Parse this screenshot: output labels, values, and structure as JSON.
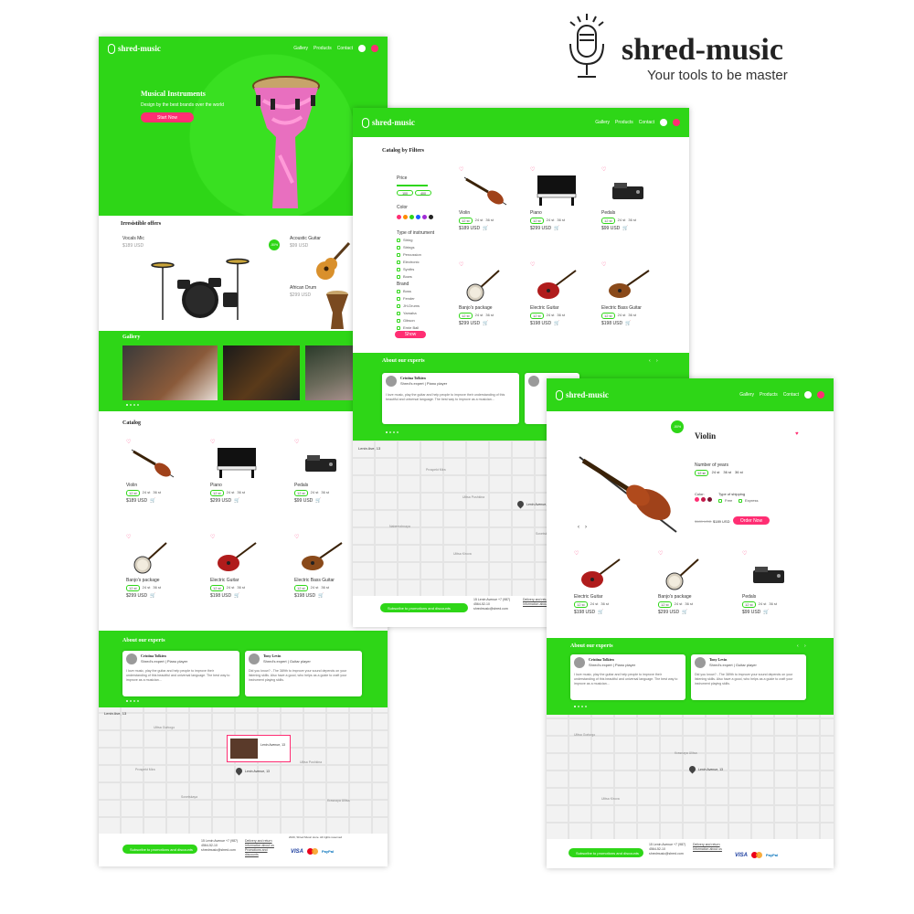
{
  "brand": {
    "name": "shred-music",
    "tagline": "Your tools to be master"
  },
  "nav": {
    "gallery": "Gallery",
    "products": "Products",
    "contact": "Contact"
  },
  "hero": {
    "title": "Musical Instruments",
    "subtitle": "Design by the best brands over the world",
    "cta": "Start Now"
  },
  "offers": {
    "title": "Irresistible offers",
    "items": [
      {
        "name": "Vocals Mic",
        "price": "$189 USD"
      },
      {
        "name": "Acoustic Guitar",
        "price": "$99 USD",
        "badge": "-50%"
      },
      {
        "name": "African Drum",
        "price": "$299 USD"
      }
    ]
  },
  "gallery_title": "Gallery",
  "catalog": {
    "title": "Catalog",
    "filters_title": "Catalog by Filters",
    "products": [
      {
        "name": "Violin",
        "price": "$189 USD",
        "chips": [
          "12 st",
          "24 st",
          "36 st"
        ]
      },
      {
        "name": "Piano",
        "price": "$299 USD",
        "chips": [
          "12 st",
          "24 st",
          "36 st"
        ]
      },
      {
        "name": "Pedals",
        "price": "$99 USD",
        "chips": [
          "12 st",
          "24 st",
          "36 st"
        ]
      },
      {
        "name": "Banjo's package",
        "price": "$299 USD",
        "chips": [
          "12 st",
          "24 st",
          "36 st"
        ]
      },
      {
        "name": "Electric Guitar",
        "price": "$198 USD",
        "chips": [
          "12 st",
          "24 st",
          "36 st"
        ]
      },
      {
        "name": "Electric Bass Guitar",
        "price": "$198 USD",
        "chips": [
          "12 st",
          "24 st",
          "36 st"
        ]
      }
    ]
  },
  "filters": {
    "price_label": "Price",
    "price_min": "100",
    "price_max": "400",
    "color_label": "Color",
    "colors": [
      "#ff2e73",
      "#ff8a00",
      "#2ed617",
      "#1a5cff",
      "#a12bd6",
      "#222222"
    ],
    "type_label": "Type of instrument",
    "types": [
      "String",
      "Strings",
      "Percussion",
      "Electronic",
      "Synths",
      "Bows"
    ],
    "brand_label": "Brand",
    "brands": [
      "Boss",
      "Fender",
      "JH-Drums",
      "Yamaha",
      "Gibson",
      "Ernie Ball"
    ],
    "show_button": "Show"
  },
  "experts": {
    "title": "About our experts",
    "list": [
      {
        "name": "Cristina Tolkien",
        "role": "Shred's expert | Piano player",
        "quote": "I love music, play the guitar and help people to improve their understanding of this beautiful and universal language. The best way to improve as a musician..."
      },
      {
        "name": "Tony Levin",
        "role": "Shred's expert | Guitar player",
        "quote": "Did you know? - The 389th to improve your sound depends on your listening skills. Also have a good, who helps as a guide to craft your instrument playing skills."
      }
    ]
  },
  "map": {
    "address_label": "Lenin Ave, 13",
    "pin_label": "Lenin Avenue, 13",
    "streets": [
      "Ulitsa Gorkogo",
      "Lenin Ave",
      "Prospekt Mira",
      "Ulitsa Pushkina",
      "Sovetskaya",
      "Krasnaya Ulitsa",
      "Naberezhnaya",
      "Ulitsa Kirova"
    ]
  },
  "footer": {
    "subscribe": "Subscribe to promotions and discounts",
    "address": "15 Lenin Avenue  +7 (987) 4564-52-10",
    "email": "shredmusic@shred.com",
    "links": [
      "Delivery and return",
      "Information about us",
      "Promotions and discounts"
    ],
    "copyright": "2020, Shred Music store. All rights reserved",
    "payments": {
      "visa": "VISA",
      "paypal": "PayPal"
    }
  },
  "product_page": {
    "title": "Violin",
    "badge": "-50%",
    "years_label": "Number of years",
    "years": [
      "12 st",
      "24 st",
      "36 st",
      "36 st"
    ],
    "color_label": "Color:",
    "shipping_label": "Type of shipping",
    "shipping": [
      "Free",
      "Express"
    ],
    "old_price": "$189 USD",
    "price": "$189 USD",
    "order": "Order Now",
    "related": [
      {
        "name": "Electric Guitar",
        "price": "$198 USD",
        "chips": [
          "12 st",
          "24 st",
          "36 st"
        ]
      },
      {
        "name": "Banjo's package",
        "price": "$299 USD",
        "chips": [
          "12 st",
          "24 st",
          "36 st"
        ]
      },
      {
        "name": "Pedals",
        "price": "$99 USD",
        "chips": [
          "12 st",
          "24 st",
          "36 st"
        ]
      }
    ]
  },
  "colors": {
    "accent": "#2ed617",
    "pink": "#ff2e73"
  }
}
